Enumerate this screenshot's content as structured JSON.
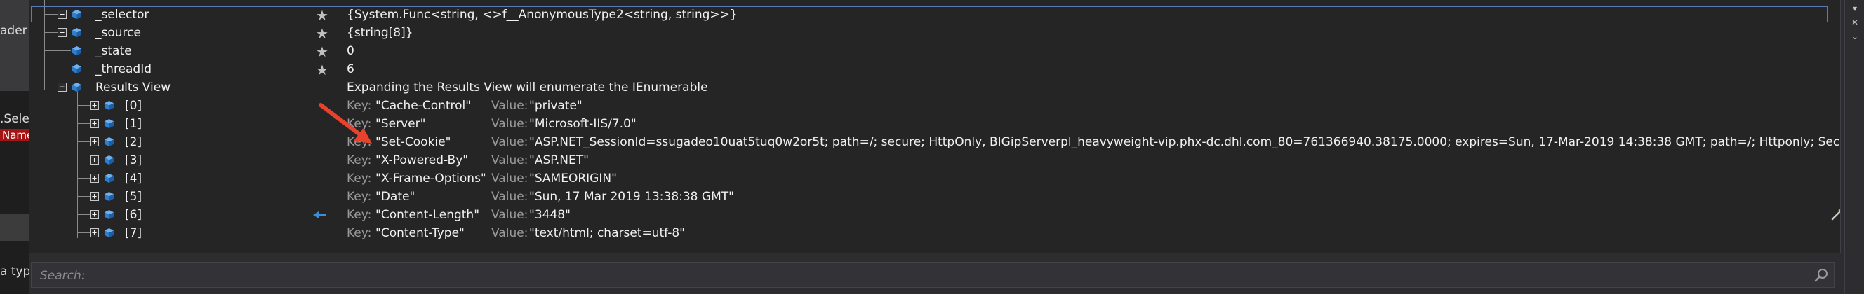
{
  "left_strip": {
    "frag1": "ader",
    "frag2": ".Sele",
    "frag3": "Name",
    "frag4": "a typ"
  },
  "rows": [
    {
      "name": "_selector",
      "value": "{System.Func<string, <>f__AnonymousType2<string, string>>}",
      "expandable": true,
      "selected": true
    },
    {
      "name": "_source",
      "value": "{string[8]}",
      "expandable": true
    },
    {
      "name": "_state",
      "value": "0",
      "expandable": false
    },
    {
      "name": "_threadId",
      "value": "6",
      "expandable": false
    },
    {
      "name": "Results View",
      "value": "Expanding the Results View will enumerate the IEnumerable",
      "expandable": true,
      "expanded": true
    }
  ],
  "kv_labels": {
    "key": "Key:",
    "value": "Value:"
  },
  "results": [
    {
      "index": "[0]",
      "key": "\"Cache-Control\"",
      "value": "\"private\""
    },
    {
      "index": "[1]",
      "key": "\"Server\"",
      "value": "\"Microsoft-IIS/7.0\""
    },
    {
      "index": "[2]",
      "key": "\"Set-Cookie\"",
      "value": "\"ASP.NET_SessionId=ssugadeo10uat5tuq0w2or5t; path=/; secure; HttpOnly, BIGipServerpl_heavyweight-vip.phx-dc.dhl.com_80=761366940.38175.0000; expires=Sun, 17-Mar-2019 14:38:38 GMT; path=/; Httponly; Secure\""
    },
    {
      "index": "[3]",
      "key": "\"X-Powered-By\"",
      "value": "\"ASP.NET\""
    },
    {
      "index": "[4]",
      "key": "\"X-Frame-Options\"",
      "value": "\"SAMEORIGIN\""
    },
    {
      "index": "[5]",
      "key": "\"Date\"",
      "value": "\"Sun, 17 Mar 2019 13:38:38 GMT\""
    },
    {
      "index": "[6]",
      "key": "\"Content-Length\"",
      "value": "\"3448\""
    },
    {
      "index": "[7]",
      "key": "\"Content-Type\"",
      "value": "\"text/html; charset=utf-8\""
    }
  ],
  "search": {
    "placeholder": "Search:"
  },
  "icons": {
    "expand": "plus-box",
    "collapse": "minus-box",
    "member": "blue-cube-icon",
    "favorite": "star-icon",
    "pinned": "pin-icon",
    "annotation": "red-arrow",
    "wand": "magic-wand-icon",
    "search": "search-icon"
  },
  "colors": {
    "background": "#252526",
    "selection_border": "#5a7bb5",
    "cube": "#3c8fd6",
    "arrow": "#e8412c",
    "label_gray": "#9b9b9b"
  }
}
